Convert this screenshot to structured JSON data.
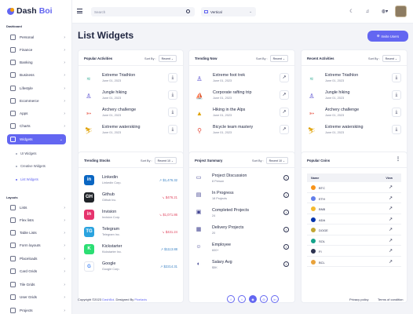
{
  "brand": {
    "name_a": "Dash",
    "name_b": "Boi"
  },
  "sidebar": {
    "dashboard_section": "Dashboard",
    "layout_section": "Layouts",
    "items": [
      {
        "label": "Personal",
        "icon": "user-icon"
      },
      {
        "label": "Finance",
        "icon": "finance-icon"
      },
      {
        "label": "Banking",
        "icon": "bank-icon"
      },
      {
        "label": "Business",
        "icon": "briefcase-icon"
      },
      {
        "label": "Lifestyle",
        "icon": "lifestyle-icon"
      },
      {
        "label": "Ecommerce",
        "icon": "cart-icon"
      },
      {
        "label": "Apps",
        "icon": "apps-icon"
      },
      {
        "label": "Charts",
        "icon": "chart-icon"
      },
      {
        "label": "Widgets",
        "icon": "widgets-icon"
      }
    ],
    "sub_items": [
      "UI Widgets",
      "Creative Widgets",
      "List Widgets"
    ],
    "layout_items": [
      {
        "label": "Lists"
      },
      {
        "label": "Flex lists"
      },
      {
        "label": "Table Lists"
      },
      {
        "label": "Form layouts"
      },
      {
        "label": "Placeloads"
      },
      {
        "label": "Card Grids"
      },
      {
        "label": "Tile Grids"
      },
      {
        "label": "User Grids"
      },
      {
        "label": "Projects"
      }
    ]
  },
  "topbar": {
    "search_placeholder": "Search",
    "layout_select": "Vertical"
  },
  "page": {
    "title": "List Widgets",
    "invite_label": "Invite Users"
  },
  "popular_activities": {
    "title": "Popular Activities",
    "sort_label": "Sort By :",
    "sort_value": "Recent",
    "items": [
      {
        "title": "Extreme Triathlon",
        "date": "June 01, 2023"
      },
      {
        "title": "Jungle hiking",
        "date": "June 01, 2023"
      },
      {
        "title": "Archery challenge",
        "date": "June 01, 2023"
      },
      {
        "title": "Extreme waterskiing",
        "date": "June 01, 2023"
      }
    ]
  },
  "trending_now": {
    "title": "Trending Now",
    "sort_label": "Sort By :",
    "sort_value": "Recent",
    "items": [
      {
        "title": "Extreme foot trek",
        "date": "June 01, 2023"
      },
      {
        "title": "Corporate rafting trip",
        "date": "June 01, 2023"
      },
      {
        "title": "Hiking in the Alps",
        "date": "June 01, 2023"
      },
      {
        "title": "Bicycle team mastery",
        "date": "June 01, 2023"
      }
    ]
  },
  "recent_activities": {
    "title": "Recent Activities",
    "sort_label": "Sort By :",
    "sort_value": "Recent",
    "items": [
      {
        "title": "Extreme Triathlon",
        "date": "June 01, 2023"
      },
      {
        "title": "Jungle hiking",
        "date": "June 01, 2023"
      },
      {
        "title": "Archery challenge",
        "date": "June 01, 2023"
      },
      {
        "title": "Extreme waterskiing",
        "date": "June 01, 2023"
      }
    ]
  },
  "trending_stocks": {
    "title": "Trending Stocks",
    "sort_label": "Sort By :",
    "sort_value": "Recent 10",
    "items": [
      {
        "name": "Linkedin",
        "company": "Linkedin Corp.",
        "value": "$1,476.32",
        "trend": "up",
        "color": "#0a66c2",
        "glyph": "in"
      },
      {
        "name": "Github",
        "company": "Github Inc.",
        "value": "$476.21",
        "trend": "down",
        "color": "#1f2328",
        "glyph": "GH"
      },
      {
        "name": "Invision",
        "company": "Invision Corp.",
        "value": "$1,071.86",
        "trend": "down",
        "color": "#e6336d",
        "glyph": "in"
      },
      {
        "name": "Telegram",
        "company": "Telegram Inc.",
        "value": "$431.24",
        "trend": "down",
        "color": "#2aa3df",
        "glyph": "TG"
      },
      {
        "name": "Kickstarter",
        "company": "Kickstarter Inc.",
        "value": "$1113.88",
        "trend": "up",
        "color": "#2bde73",
        "glyph": "K"
      },
      {
        "name": "Google",
        "company": "Google Corp.",
        "value": "$2214.31",
        "trend": "up",
        "color": "#ffffff",
        "glyph": "G"
      }
    ]
  },
  "project_summary": {
    "title": "Project Summary",
    "sort_label": "Sort By :",
    "sort_value": "Recent 10",
    "items": [
      {
        "title": "Project Discussion",
        "sub": "8 Person"
      },
      {
        "title": "In Progress",
        "sub": "18 Projects"
      },
      {
        "title": "Completed Projects",
        "sub": "24"
      },
      {
        "title": "Delivery Projects",
        "sub": "20"
      },
      {
        "title": "Employee",
        "sub": "600+"
      },
      {
        "title": "Salary Avg",
        "sub": "$5K"
      }
    ]
  },
  "popular_coins": {
    "title": "Popular Coins",
    "col_name": "Name",
    "col_view": "View",
    "items": [
      {
        "name": "BTC",
        "color": "#f7931a"
      },
      {
        "name": "ETH",
        "color": "#627eea"
      },
      {
        "name": "BNB",
        "color": "#f3ba2f"
      },
      {
        "name": "ADA",
        "color": "#0033ad"
      },
      {
        "name": "DOGE",
        "color": "#c2a633"
      },
      {
        "name": "SOL",
        "color": "#14a38b"
      },
      {
        "name": "FI",
        "color": "#2d3250"
      },
      {
        "name": "BCL",
        "color": "#e9a23b"
      }
    ]
  },
  "footer": {
    "copyright_prefix": "Copyright ©2023",
    "brand_link": "DashBoi",
    "designed_by": ". Designed By",
    "designer_link": "Pixelaxis",
    "privacy": "Privacy policy",
    "terms": "Terms of condition"
  },
  "colors": {
    "accent": "#6366f1",
    "up": "#3b82c4",
    "down": "#e0445e"
  }
}
